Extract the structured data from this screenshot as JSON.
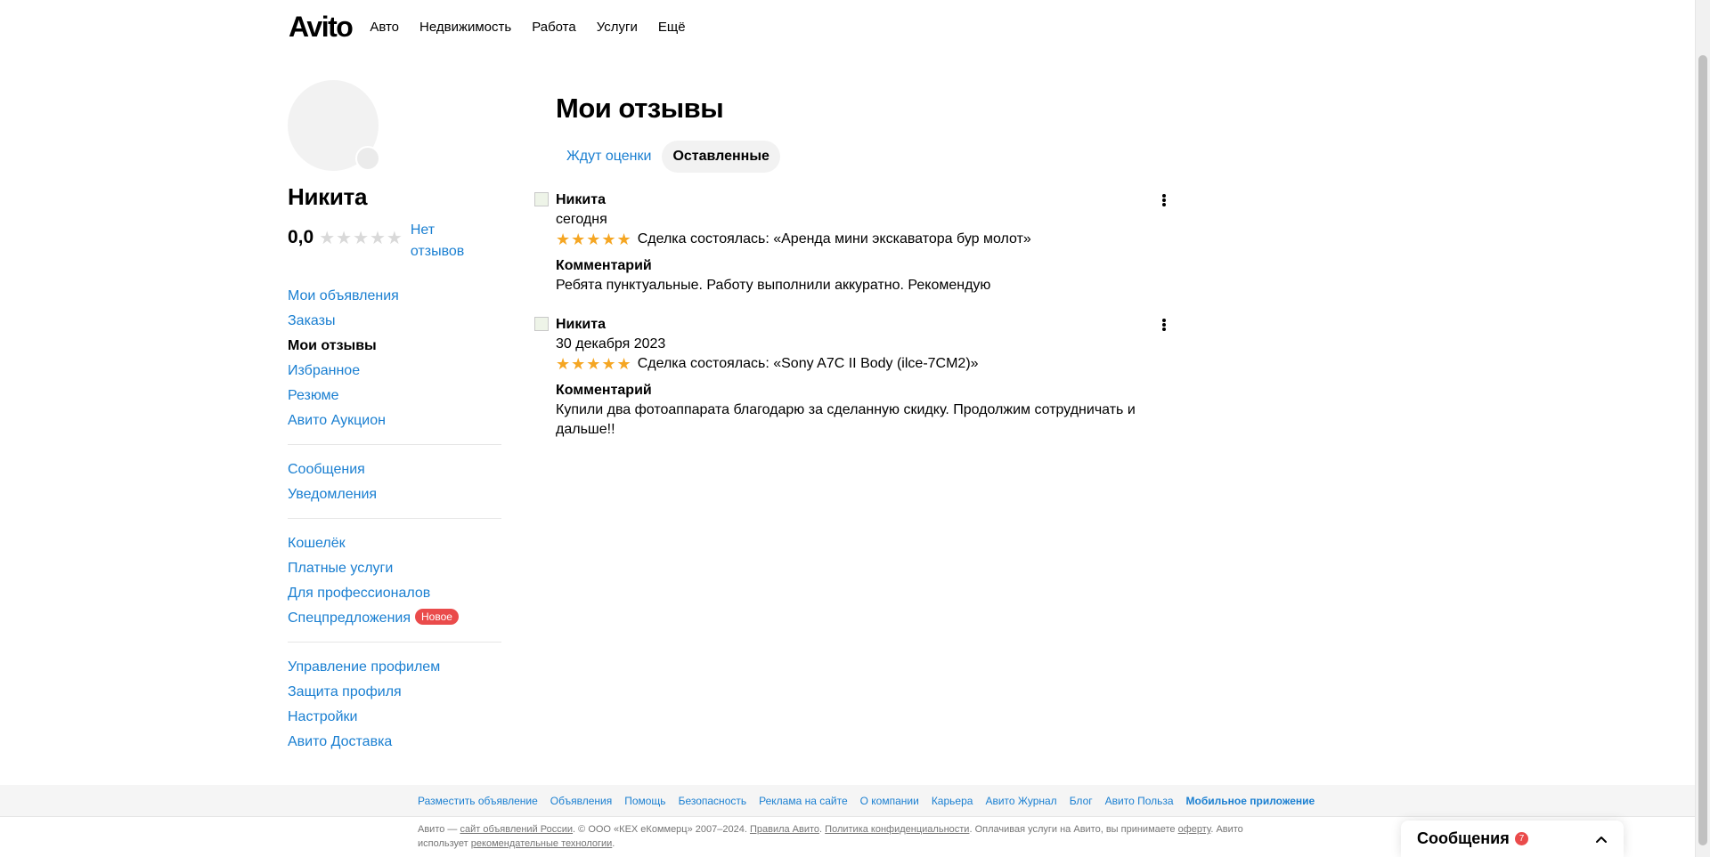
{
  "header": {
    "logo": "Avito",
    "nav": [
      "Авто",
      "Недвижимость",
      "Работа",
      "Услуги",
      "Ещё"
    ]
  },
  "profile": {
    "name": "Никита",
    "rating": "0,0",
    "stars": "★★★★★",
    "no_reviews": "Нет отзывов"
  },
  "sidebar": {
    "group1": [
      "Мои объявления",
      "Заказы",
      "Мои отзывы",
      "Избранное",
      "Резюме",
      "Авито Аукцион"
    ],
    "group2": [
      "Сообщения",
      "Уведомления"
    ],
    "group3": [
      "Кошелёк",
      "Платные услуги",
      "Для профессионалов",
      "Спецпредложения"
    ],
    "new_badge": "Новое",
    "group4": [
      "Управление профилем",
      "Защита профиля",
      "Настройки",
      "Авито Доставка"
    ]
  },
  "main": {
    "title": "Мои отзывы",
    "tabs": [
      "Ждут оценки",
      "Оставленные"
    ],
    "reviews": [
      {
        "author": "Никита",
        "date": "сегодня",
        "stars": "★★★★★",
        "deal": "Сделка состоялась: «Аренда мини экскаватора бур молот»",
        "comment_label": "Комментарий",
        "comment": "Ребята пунктуальные. Работу выполнили аккуратно. Рекомендую"
      },
      {
        "author": "Никита",
        "date": "30 декабря 2023",
        "stars": "★★★★★",
        "deal": "Сделка состоялась: «Sony A7C II Body (ilce-7CM2)»",
        "comment_label": "Комментарий",
        "comment": "Купили два фотоаппарата благодарю за сделанную скидку. Продолжим сотрудничать и дальше!!"
      }
    ]
  },
  "footer": {
    "links": [
      "Разместить объявление",
      "Объявления",
      "Помощь",
      "Безопасность",
      "Реклама на сайте",
      "О компании",
      "Карьера",
      "Авито Журнал",
      "Блог",
      "Авито Польза",
      "Мобильное приложение"
    ],
    "copy": {
      "p1": "Авито — ",
      "l1": "сайт объявлений России",
      "p2": ". © ООО «КЕХ еКоммерц» 2007–2024. ",
      "l2": "Правила Авито",
      "p3": ". ",
      "l3": "Политика конфиденциальности",
      "p4": ". Оплачивая услуги на Авито, вы принимаете ",
      "l4": "оферту",
      "p5": ". Авито использует ",
      "l5": "рекомендательные технологии",
      "p6": "."
    }
  },
  "messages_widget": {
    "title": "Сообщения",
    "count": "7"
  }
}
